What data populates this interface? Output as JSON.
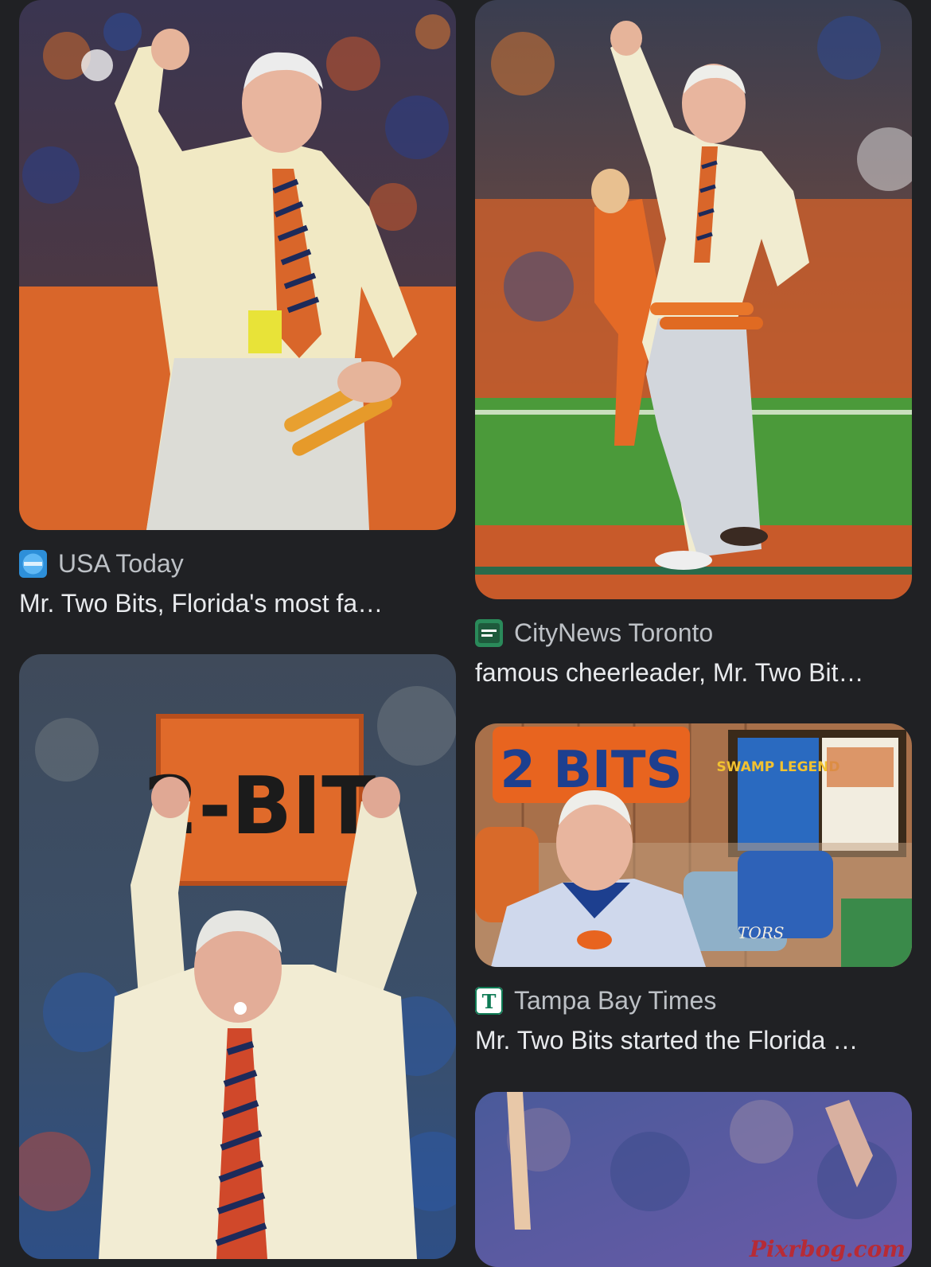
{
  "results": [
    {
      "source": "USA Today",
      "favicon": "usa-today-logo",
      "caption": "Mr. Two Bits, Florida's most fa…"
    },
    {
      "source": "CityNews Toronto",
      "favicon": "citynews-logo",
      "caption": "famous cheerleader, Mr. Two Bit…"
    },
    {
      "source": "Tampa Bay Times",
      "favicon": "tampa-bay-times-logo",
      "caption": "Mr. Two Bits started the Florida …"
    }
  ],
  "image_text": {
    "sign_2bits": "2-BIT",
    "wall_sign": "2 BITS",
    "poster_title": "SWAMP LEGEND",
    "pillow_text": "TORS",
    "watermark": "Pixrbog.com"
  },
  "colors": {
    "background": "#202124",
    "source_text": "#bdc1c6",
    "caption_text": "#e8eaed",
    "gator_orange": "#e8661f",
    "gator_blue": "#1d3f8f"
  }
}
